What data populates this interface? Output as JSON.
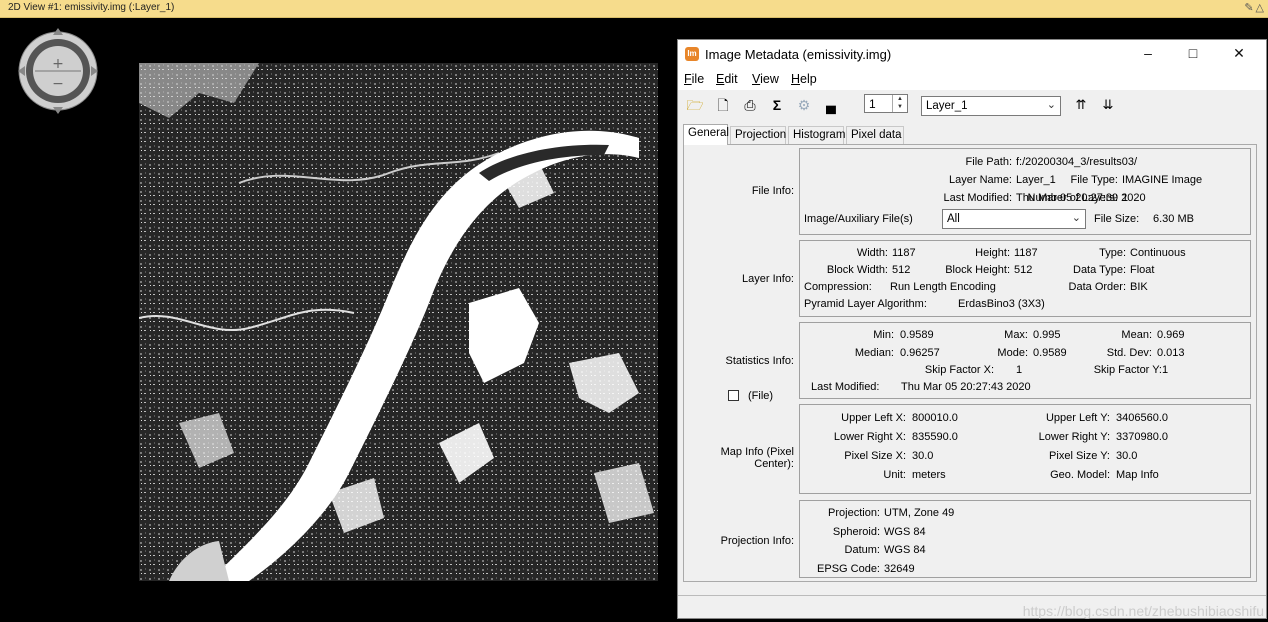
{
  "viewer": {
    "title": "2D View #1: emissivity.img (:Layer_1)"
  },
  "window": {
    "title": "Image Metadata (emissivity.img)",
    "icon": "Im",
    "menus": [
      "File",
      "Edit",
      "View",
      "Help"
    ],
    "layer_number": "1",
    "layer_select": "Layer_1"
  },
  "tabs": [
    "General",
    "Projection",
    "Histogram",
    "Pixel data"
  ],
  "file_info": {
    "section_label": "File Info:",
    "file_path_label": "File Path:",
    "file_path": "f:/20200304_3/results03/",
    "layer_name_label": "Layer Name:",
    "layer_name": "Layer_1",
    "file_type_label": "File Type:",
    "file_type": "IMAGINE Image",
    "last_modified_label": "Last Modified:",
    "last_modified": "Thu Mar 05 20:27:39 2020",
    "num_layers_label": "Number of Layers:",
    "num_layers": "1",
    "aux_label": "Image/Auxiliary File(s)",
    "aux_value": "All",
    "file_size_label": "File Size:",
    "file_size": "6.30 MB"
  },
  "layer_info": {
    "section_label": "Layer Info:",
    "width_label": "Width:",
    "width": "1187",
    "height_label": "Height:",
    "height": "1187",
    "type_label": "Type:",
    "type": "Continuous",
    "block_width_label": "Block Width:",
    "block_width": "512",
    "block_height_label": "Block Height:",
    "block_height": "512",
    "data_type_label": "Data Type:",
    "data_type": "Float",
    "compression_label": "Compression:",
    "compression": "Run Length Encoding",
    "data_order_label": "Data Order:",
    "data_order": "BIK",
    "pyramid_label": "Pyramid Layer Algorithm:",
    "pyramid": "ErdasBino3 (3X3)"
  },
  "stats_info": {
    "section_label": "Statistics Info:",
    "min_label": "Min:",
    "min": "0.9589",
    "max_label": "Max:",
    "max": "0.995",
    "mean_label": "Mean:",
    "mean": "0.969",
    "median_label": "Median:",
    "median": "0.96257",
    "mode_label": "Mode:",
    "mode": "0.9589",
    "std_label": "Std. Dev:",
    "std": "0.013",
    "skip_x_label": "Skip Factor X:",
    "skip_x": "1",
    "skip_y_label": "Skip Factor Y:",
    "skip_y": "1",
    "last_modified_label": "Last Modified:",
    "last_modified": "Thu Mar 05 20:27:43 2020",
    "file_checkbox_label": "(File)"
  },
  "map_info": {
    "section_label": "Map Info (Pixel Center):",
    "ulx_label": "Upper Left X:",
    "ulx": "800010.0",
    "uly_label": "Upper Left Y:",
    "uly": "3406560.0",
    "lrx_label": "Lower Right X:",
    "lrx": "835590.0",
    "lry_label": "Lower Right Y:",
    "lry": "3370980.0",
    "psx_label": "Pixel Size X:",
    "psx": "30.0",
    "psy_label": "Pixel Size Y:",
    "psy": "30.0",
    "unit_label": "Unit:",
    "unit": "meters",
    "geo_label": "Geo. Model:",
    "geo": "Map Info"
  },
  "proj_info": {
    "section_label": "Projection Info:",
    "projection_label": "Projection:",
    "projection": "UTM, Zone 49",
    "spheroid_label": "Spheroid:",
    "spheroid": "WGS 84",
    "datum_label": "Datum:",
    "datum": "WGS 84",
    "epsg_label": "EPSG Code:",
    "epsg": "32649"
  },
  "watermark": "https://blog.csdn.net/zhebushibiaoshifu"
}
